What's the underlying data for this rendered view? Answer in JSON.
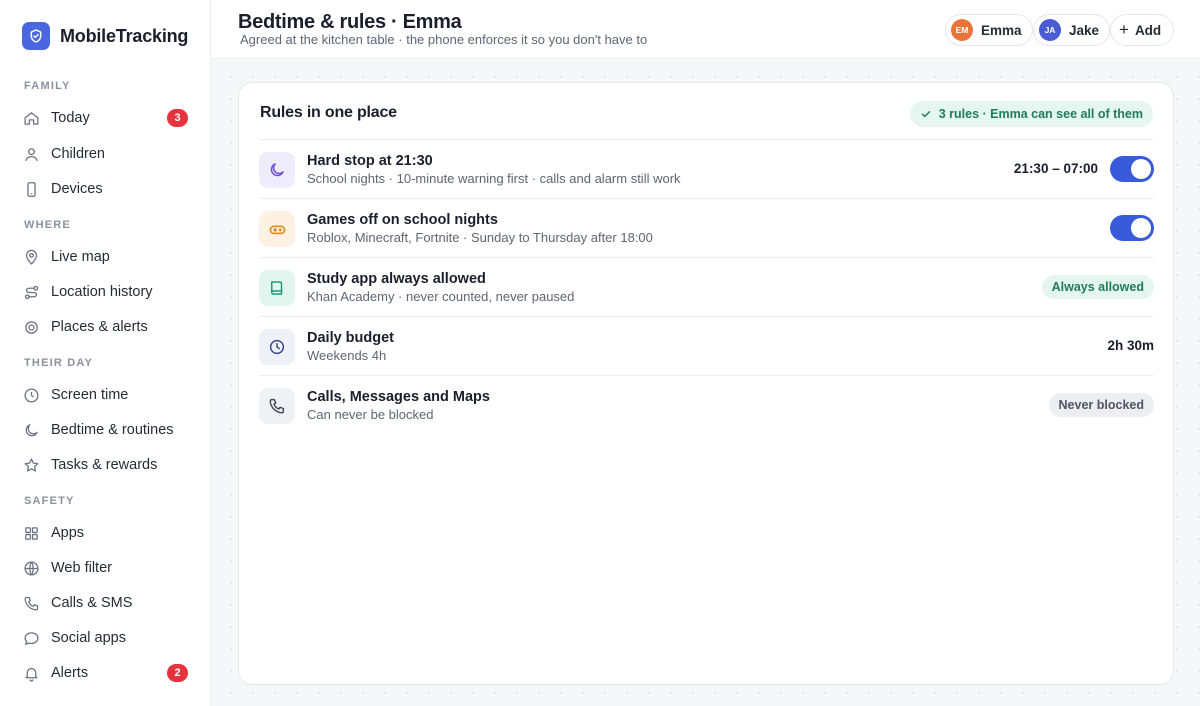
{
  "app": {
    "name": "MobileTracking"
  },
  "colors": {
    "accent": "#3a5bd9",
    "badge": "#e5343d",
    "success": "#1f7d5a",
    "emma": "#e8743b",
    "jake": "#4a5bd6"
  },
  "sidebar": {
    "sections": [
      {
        "label": "FAMILY"
      },
      {
        "label": "WHERE"
      },
      {
        "label": "THEIR DAY"
      },
      {
        "label": "SAFETY"
      }
    ],
    "items": [
      {
        "label": "Today",
        "icon": "home-icon",
        "badge": "3"
      },
      {
        "label": "Children",
        "icon": "person-icon"
      },
      {
        "label": "Devices",
        "icon": "phone-icon"
      },
      {
        "label": "Live map",
        "icon": "map-pin-icon"
      },
      {
        "label": "Location history",
        "icon": "route-icon"
      },
      {
        "label": "Places & alerts",
        "icon": "target-icon"
      },
      {
        "label": "Screen time",
        "icon": "clock-icon"
      },
      {
        "label": "Bedtime & routines",
        "icon": "moon-icon"
      },
      {
        "label": "Tasks & rewards",
        "icon": "star-icon"
      },
      {
        "label": "Apps",
        "icon": "grid-icon"
      },
      {
        "label": "Web filter",
        "icon": "globe-icon"
      },
      {
        "label": "Calls & SMS",
        "icon": "phone-call-icon"
      },
      {
        "label": "Social apps",
        "icon": "chat-bubble-icon"
      },
      {
        "label": "Alerts",
        "icon": "bell-icon",
        "badge": "2"
      }
    ]
  },
  "header": {
    "title": "Bedtime & rules · Emma",
    "subtitle": "Agreed at the kitchen table · the phone enforces it so you don't have to",
    "children": [
      {
        "initials": "EM",
        "name": "Emma"
      },
      {
        "initials": "JA",
        "name": "Jake"
      }
    ],
    "add_label": "Add"
  },
  "card": {
    "title": "Rules in one place",
    "summary": "3 rules · Emma can see all of them",
    "rules": [
      {
        "icon": "moon-icon",
        "title": "Hard stop at 21:30",
        "desc": "School nights · 10-minute warning first · calls and alarm still work",
        "value": "21:30 – 07:00",
        "toggle": true
      },
      {
        "icon": "gamepad-icon",
        "title": "Games off on school nights",
        "desc": "Roblox, Minecraft, Fortnite · Sunday to Thursday after 18:00",
        "toggle": true
      },
      {
        "icon": "book-icon",
        "title": "Study app always allowed",
        "desc": "Khan Academy · never counted, never paused",
        "pill": "Always allowed"
      },
      {
        "icon": "clock-icon",
        "title": "Daily budget",
        "desc": "Weekends 4h",
        "value": "2h 30m"
      },
      {
        "icon": "phone-icon",
        "title": "Calls, Messages and Maps",
        "desc": "Can never be blocked",
        "pill": "Never blocked"
      }
    ]
  }
}
